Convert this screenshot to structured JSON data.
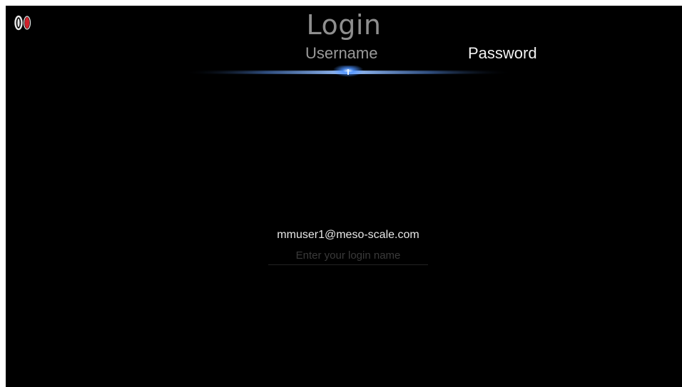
{
  "header": {
    "title": "Login",
    "tabs": [
      {
        "label": "Username",
        "active": true
      },
      {
        "label": "Password",
        "active": false
      }
    ]
  },
  "form": {
    "username_value": "mmuser1@meso-scale.com",
    "username_placeholder": "Enter your login name"
  },
  "colors": {
    "background": "#000000",
    "accent_glow": "#4a90ff",
    "logo_red": "#d0202a",
    "logo_white": "#e8e8e8"
  },
  "icons": {
    "logo": "app-logo-icon",
    "tab_indicator": "selection-glow-indicator"
  }
}
